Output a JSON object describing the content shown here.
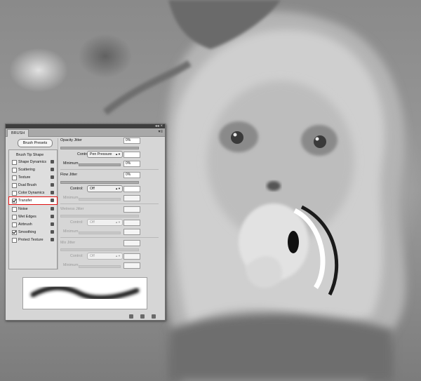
{
  "panel": {
    "tab_label": "BRUSH",
    "topbar_controls": "◂◂ ×",
    "menu_icon": "panel-menu-icon",
    "presets_button": "Brush Presets",
    "items": [
      {
        "label": "Brush Tip Shape",
        "checked": false,
        "has_lock": false,
        "selected": false
      },
      {
        "label": "Shape Dynamics",
        "checked": false,
        "has_lock": true,
        "selected": false
      },
      {
        "label": "Scattering",
        "checked": false,
        "has_lock": true,
        "selected": false
      },
      {
        "label": "Texture",
        "checked": false,
        "has_lock": true,
        "selected": false
      },
      {
        "label": "Dual Brush",
        "checked": false,
        "has_lock": true,
        "selected": false
      },
      {
        "label": "Color Dynamics",
        "checked": false,
        "has_lock": true,
        "selected": false
      },
      {
        "label": "Transfer",
        "checked": true,
        "has_lock": true,
        "selected": true
      },
      {
        "label": "Noise",
        "checked": false,
        "has_lock": true,
        "selected": false
      },
      {
        "label": "Wet Edges",
        "checked": false,
        "has_lock": true,
        "selected": false
      },
      {
        "label": "Airbrush",
        "checked": false,
        "has_lock": true,
        "selected": false
      },
      {
        "label": "Smoothing",
        "checked": true,
        "has_lock": true,
        "selected": false
      },
      {
        "label": "Protect Texture",
        "checked": false,
        "has_lock": true,
        "selected": false
      }
    ],
    "opacity_jitter": {
      "label": "Opacity Jitter",
      "value": "0%"
    },
    "opacity_control": {
      "label": "Control:",
      "selected": "Pen Pressure",
      "value": ""
    },
    "opacity_minimum": {
      "label": "Minimum",
      "value": "0%"
    },
    "flow_jitter": {
      "label": "Flow Jitter",
      "value": "0%"
    },
    "flow_control": {
      "label": "Control:",
      "selected": "Off",
      "value": ""
    },
    "flow_minimum": {
      "label": "Minimum",
      "value": ""
    },
    "wetness_jitter": {
      "label": "Wetness Jitter",
      "value": ""
    },
    "wetness_control": {
      "label": "Control:",
      "selected": "Off",
      "value": ""
    },
    "wetness_minimum": {
      "label": "Minimum",
      "value": ""
    },
    "mix_jitter": {
      "label": "Mix Jitter",
      "value": ""
    },
    "mix_control": {
      "label": "Control:",
      "selected": "Off",
      "value": ""
    },
    "mix_minimum": {
      "label": "Minimum",
      "value": ""
    },
    "footer_icons": [
      "toggle-preview-icon",
      "new-brush-icon",
      "delete-icon"
    ]
  },
  "colors": {
    "selection_outline": "#e01010",
    "panel_bg": "#d6d6d6"
  }
}
